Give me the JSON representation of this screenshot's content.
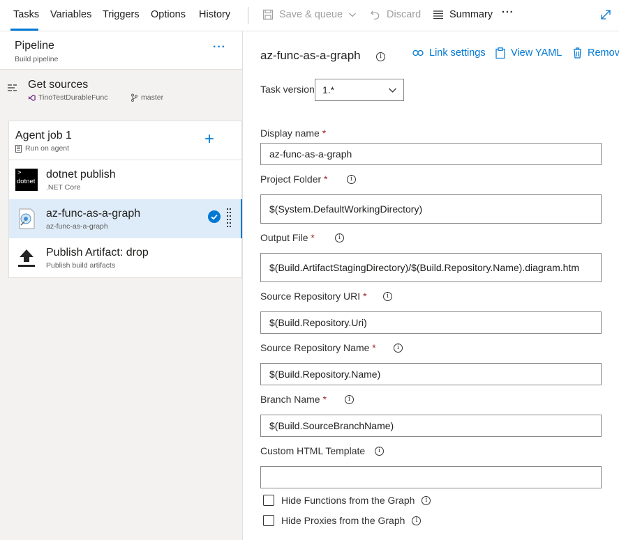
{
  "tabs": [
    "Tasks",
    "Variables",
    "Triggers",
    "Options",
    "History"
  ],
  "toolbar": {
    "save_queue": "Save & queue",
    "discard": "Discard",
    "summary": "Summary",
    "more": "···"
  },
  "pipeline": {
    "title": "Pipeline",
    "subtitle": "Build pipeline",
    "more": "···"
  },
  "get_sources": {
    "title": "Get sources",
    "repo": "TinoTestDurableFunc",
    "branch": "master"
  },
  "agent_job": {
    "title": "Agent job 1",
    "subtitle": "Run on agent",
    "add": "+"
  },
  "tasks": [
    {
      "title": "dotnet publish",
      "subtitle": ".NET Core",
      "icon_text": "dotnet"
    },
    {
      "title": "az-func-as-a-graph",
      "subtitle": "az-func-as-a-graph"
    },
    {
      "title": "Publish Artifact: drop",
      "subtitle": "Publish build artifacts"
    }
  ],
  "detail": {
    "title": "az-func-as-a-graph",
    "link_settings": "Link settings",
    "view_yaml": "View YAML",
    "remove": "Remove",
    "task_version_label": "Task version",
    "task_version_value": "1.*",
    "fields": [
      {
        "label": "Display name",
        "required": "*",
        "value": "az-func-as-a-graph"
      },
      {
        "label": "Project Folder",
        "required": "*",
        "value": "$(System.DefaultWorkingDirectory)"
      },
      {
        "label": "Output File",
        "required": "*",
        "value": "$(Build.ArtifactStagingDirectory)/$(Build.Repository.Name).diagram.htm"
      },
      {
        "label": "Source Repository URI",
        "required": "*",
        "value": "$(Build.Repository.Uri)"
      },
      {
        "label": "Source Repository Name",
        "required": "*",
        "value": "$(Build.Repository.Name)"
      },
      {
        "label": "Branch Name",
        "required": "*",
        "value": "$(Build.SourceBranchName)"
      },
      {
        "label": "Custom HTML Template",
        "required": "",
        "value": ""
      }
    ],
    "checkboxes": [
      {
        "label": "Hide Functions from the Graph",
        "checked": false
      },
      {
        "label": "Hide Proxies from the Graph",
        "checked": false
      }
    ],
    "info_glyph": "i"
  },
  "colors": {
    "accent": "#0078d4",
    "selected_bg": "#deecf9",
    "required": "#a4262c"
  }
}
